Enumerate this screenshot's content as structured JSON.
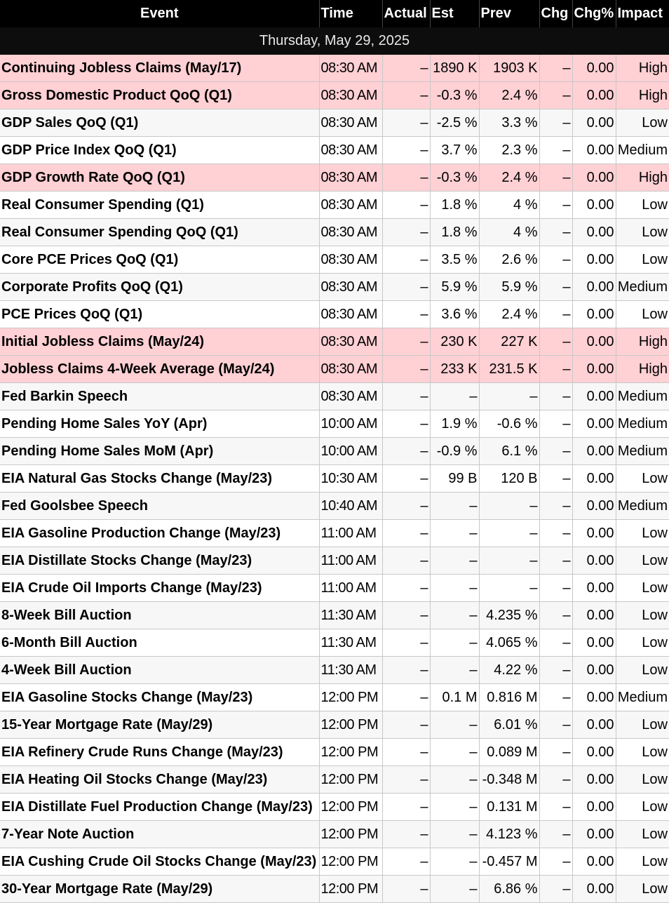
{
  "columns": [
    "Event",
    "Time",
    "Actual",
    "Est",
    "Prev",
    "Chg",
    "Chg%",
    "Impact"
  ],
  "date_header": "Thursday, May 29, 2025",
  "rows": [
    {
      "event": "Continuing Jobless Claims (May/17)",
      "time": "08:30 AM",
      "actual": "–",
      "est": "1890 K",
      "prev": "1903 K",
      "chg": "–",
      "chg_pct": "0.00",
      "impact": "High"
    },
    {
      "event": "Gross Domestic Product QoQ (Q1)",
      "time": "08:30 AM",
      "actual": "–",
      "est": "-0.3 %",
      "prev": "2.4 %",
      "chg": "–",
      "chg_pct": "0.00",
      "impact": "High"
    },
    {
      "event": "GDP Sales QoQ (Q1)",
      "time": "08:30 AM",
      "actual": "–",
      "est": "-2.5 %",
      "prev": "3.3 %",
      "chg": "–",
      "chg_pct": "0.00",
      "impact": "Low"
    },
    {
      "event": "GDP Price Index QoQ (Q1)",
      "time": "08:30 AM",
      "actual": "–",
      "est": "3.7 %",
      "prev": "2.3 %",
      "chg": "–",
      "chg_pct": "0.00",
      "impact": "Medium"
    },
    {
      "event": "GDP Growth Rate QoQ (Q1)",
      "time": "08:30 AM",
      "actual": "–",
      "est": "-0.3 %",
      "prev": "2.4 %",
      "chg": "–",
      "chg_pct": "0.00",
      "impact": "High"
    },
    {
      "event": "Real Consumer Spending (Q1)",
      "time": "08:30 AM",
      "actual": "–",
      "est": "1.8 %",
      "prev": "4 %",
      "chg": "–",
      "chg_pct": "0.00",
      "impact": "Low"
    },
    {
      "event": "Real Consumer Spending QoQ (Q1)",
      "time": "08:30 AM",
      "actual": "–",
      "est": "1.8 %",
      "prev": "4 %",
      "chg": "–",
      "chg_pct": "0.00",
      "impact": "Low"
    },
    {
      "event": "Core PCE Prices QoQ (Q1)",
      "time": "08:30 AM",
      "actual": "–",
      "est": "3.5 %",
      "prev": "2.6 %",
      "chg": "–",
      "chg_pct": "0.00",
      "impact": "Low"
    },
    {
      "event": "Corporate Profits QoQ (Q1)",
      "time": "08:30 AM",
      "actual": "–",
      "est": "5.9 %",
      "prev": "5.9 %",
      "chg": "–",
      "chg_pct": "0.00",
      "impact": "Medium"
    },
    {
      "event": "PCE Prices QoQ (Q1)",
      "time": "08:30 AM",
      "actual": "–",
      "est": "3.6 %",
      "prev": "2.4 %",
      "chg": "–",
      "chg_pct": "0.00",
      "impact": "Low"
    },
    {
      "event": "Initial Jobless Claims (May/24)",
      "time": "08:30 AM",
      "actual": "–",
      "est": "230 K",
      "prev": "227 K",
      "chg": "–",
      "chg_pct": "0.00",
      "impact": "High"
    },
    {
      "event": "Jobless Claims 4-Week Average (May/24)",
      "time": "08:30 AM",
      "actual": "–",
      "est": "233 K",
      "prev": "231.5 K",
      "chg": "–",
      "chg_pct": "0.00",
      "impact": "High"
    },
    {
      "event": "Fed Barkin Speech",
      "time": "08:30 AM",
      "actual": "–",
      "est": "–",
      "prev": "–",
      "chg": "–",
      "chg_pct": "0.00",
      "impact": "Medium"
    },
    {
      "event": "Pending Home Sales YoY (Apr)",
      "time": "10:00 AM",
      "actual": "–",
      "est": "1.9 %",
      "prev": "-0.6 %",
      "chg": "–",
      "chg_pct": "0.00",
      "impact": "Medium"
    },
    {
      "event": "Pending Home Sales MoM (Apr)",
      "time": "10:00 AM",
      "actual": "–",
      "est": "-0.9 %",
      "prev": "6.1 %",
      "chg": "–",
      "chg_pct": "0.00",
      "impact": "Medium"
    },
    {
      "event": "EIA Natural Gas Stocks Change (May/23)",
      "time": "10:30 AM",
      "actual": "–",
      "est": "99 B",
      "prev": "120 B",
      "chg": "–",
      "chg_pct": "0.00",
      "impact": "Low"
    },
    {
      "event": "Fed Goolsbee Speech",
      "time": "10:40 AM",
      "actual": "–",
      "est": "–",
      "prev": "–",
      "chg": "–",
      "chg_pct": "0.00",
      "impact": "Medium"
    },
    {
      "event": "EIA Gasoline Production Change (May/23)",
      "time": "11:00 AM",
      "actual": "–",
      "est": "–",
      "prev": "–",
      "chg": "–",
      "chg_pct": "0.00",
      "impact": "Low"
    },
    {
      "event": "EIA Distillate Stocks Change (May/23)",
      "time": "11:00 AM",
      "actual": "–",
      "est": "–",
      "prev": "–",
      "chg": "–",
      "chg_pct": "0.00",
      "impact": "Low"
    },
    {
      "event": "EIA Crude Oil Imports Change (May/23)",
      "time": "11:00 AM",
      "actual": "–",
      "est": "–",
      "prev": "–",
      "chg": "–",
      "chg_pct": "0.00",
      "impact": "Low"
    },
    {
      "event": "8-Week Bill Auction",
      "time": "11:30 AM",
      "actual": "–",
      "est": "–",
      "prev": "4.235 %",
      "chg": "–",
      "chg_pct": "0.00",
      "impact": "Low"
    },
    {
      "event": "6-Month Bill Auction",
      "time": "11:30 AM",
      "actual": "–",
      "est": "–",
      "prev": "4.065 %",
      "chg": "–",
      "chg_pct": "0.00",
      "impact": "Low"
    },
    {
      "event": "4-Week Bill Auction",
      "time": "11:30 AM",
      "actual": "–",
      "est": "–",
      "prev": "4.22 %",
      "chg": "–",
      "chg_pct": "0.00",
      "impact": "Low"
    },
    {
      "event": "EIA Gasoline Stocks Change (May/23)",
      "time": "12:00 PM",
      "actual": "–",
      "est": "0.1 M",
      "prev": "0.816 M",
      "chg": "–",
      "chg_pct": "0.00",
      "impact": "Medium"
    },
    {
      "event": "15-Year Mortgage Rate (May/29)",
      "time": "12:00 PM",
      "actual": "–",
      "est": "–",
      "prev": "6.01 %",
      "chg": "–",
      "chg_pct": "0.00",
      "impact": "Low"
    },
    {
      "event": "EIA Refinery Crude Runs Change (May/23)",
      "time": "12:00 PM",
      "actual": "–",
      "est": "–",
      "prev": "0.089 M",
      "chg": "–",
      "chg_pct": "0.00",
      "impact": "Low"
    },
    {
      "event": "EIA Heating Oil Stocks Change (May/23)",
      "time": "12:00 PM",
      "actual": "–",
      "est": "–",
      "prev": "-0.348 M",
      "chg": "–",
      "chg_pct": "0.00",
      "impact": "Low"
    },
    {
      "event": "EIA Distillate Fuel Production Change (May/23)",
      "time": "12:00 PM",
      "actual": "–",
      "est": "–",
      "prev": "0.131 M",
      "chg": "–",
      "chg_pct": "0.00",
      "impact": "Low"
    },
    {
      "event": "7-Year Note Auction",
      "time": "12:00 PM",
      "actual": "–",
      "est": "–",
      "prev": "4.123 %",
      "chg": "–",
      "chg_pct": "0.00",
      "impact": "Low"
    },
    {
      "event": "EIA Cushing Crude Oil Stocks Change (May/23)",
      "time": "12:00 PM",
      "actual": "–",
      "est": "–",
      "prev": "-0.457 M",
      "chg": "–",
      "chg_pct": "0.00",
      "impact": "Low"
    },
    {
      "event": "30-Year Mortgage Rate (May/29)",
      "time": "12:00 PM",
      "actual": "–",
      "est": "–",
      "prev": "6.86 %",
      "chg": "–",
      "chg_pct": "0.00",
      "impact": "Low"
    }
  ]
}
